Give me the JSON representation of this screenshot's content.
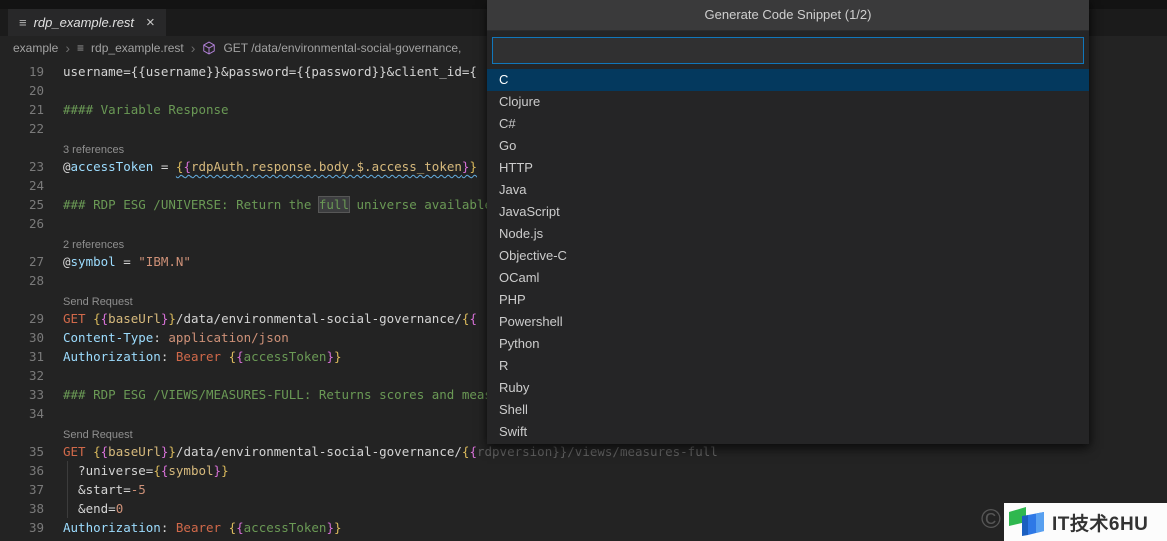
{
  "palette": {
    "plain": "#d4d4d4",
    "comment": "#6a9955",
    "lightBlue": "#9cdcfe",
    "string": "#ce9178",
    "method": "#d1694a",
    "braceGold": "#d9b95c",
    "bracePink": "#d670d6",
    "varGold": "#d7ba7d",
    "green": "#6a9955",
    "dim": "#606060",
    "accent_blue": "#1177bb",
    "selection_bg": "#04395e",
    "brand_green": "#2fb84f",
    "brand_blue": "#2e78e6"
  },
  "tab": {
    "icon_glyph": "≡",
    "title": "rdp_example.rest",
    "close_glyph": "×"
  },
  "breadcrumb": {
    "separator": "›",
    "file_icon_glyph": "≡",
    "segments": [
      "example",
      "rdp_example.rest"
    ],
    "symbol_label": "GET /data/environmental-social-governance,"
  },
  "editor": {
    "rows": [
      {
        "n": 19,
        "seg": [
          [
            "username={{username}}&password={{password}}&client_id={",
            "plain"
          ]
        ]
      },
      {
        "n": 20,
        "seg": []
      },
      {
        "n": 21,
        "seg": [
          [
            "#### Variable Response",
            "comment"
          ]
        ]
      },
      {
        "n": 22,
        "seg": []
      },
      {
        "lens": "3 references"
      },
      {
        "n": 23,
        "seg": [
          [
            "@",
            "plain"
          ],
          [
            "accessToken",
            "lightBlue"
          ],
          [
            " = ",
            "plain"
          ],
          [
            "{",
            "braceGold",
            "wavy"
          ],
          [
            "{",
            "bracePink",
            "wavy"
          ],
          [
            "rdpAuth.response.body.$.access_token",
            "varGold",
            "wavy"
          ],
          [
            "}",
            "bracePink",
            "wavy"
          ],
          [
            "}",
            "braceGold",
            "wavy"
          ]
        ]
      },
      {
        "n": 24,
        "seg": []
      },
      {
        "n": 25,
        "seg": [
          [
            "### RDP ESG /UNIVERSE: Return the ",
            "comment"
          ],
          [
            "full",
            "comment",
            "hl"
          ],
          [
            " universe available",
            "comment"
          ]
        ]
      },
      {
        "n": 26,
        "seg": []
      },
      {
        "lens": "2 references"
      },
      {
        "n": 27,
        "seg": [
          [
            "@",
            "plain"
          ],
          [
            "symbol",
            "lightBlue"
          ],
          [
            " = ",
            "plain"
          ],
          [
            "\"IBM.N\"",
            "string"
          ]
        ]
      },
      {
        "n": 28,
        "seg": []
      },
      {
        "lens": "Send Request"
      },
      {
        "n": 29,
        "seg": [
          [
            "GET",
            "method"
          ],
          [
            " ",
            "plain"
          ],
          [
            "{",
            "braceGold"
          ],
          [
            "{",
            "bracePink"
          ],
          [
            "baseUrl",
            "varGold"
          ],
          [
            "}",
            "bracePink"
          ],
          [
            "}",
            "braceGold"
          ],
          [
            "/data/environmental-social-governance/",
            "plain"
          ],
          [
            "{",
            "braceGold"
          ],
          [
            "{",
            "bracePink"
          ]
        ]
      },
      {
        "n": 30,
        "seg": [
          [
            "Content-Type",
            "lightBlue"
          ],
          [
            ":",
            "plain"
          ],
          [
            " application/json",
            "string"
          ]
        ]
      },
      {
        "n": 31,
        "seg": [
          [
            "Authorization",
            "lightBlue"
          ],
          [
            ": ",
            "plain"
          ],
          [
            "Bearer",
            "method"
          ],
          [
            " ",
            "plain"
          ],
          [
            "{",
            "braceGold"
          ],
          [
            "{",
            "bracePink"
          ],
          [
            "accessToken",
            "green"
          ],
          [
            "}",
            "bracePink"
          ],
          [
            "}",
            "braceGold"
          ]
        ]
      },
      {
        "n": 32,
        "seg": []
      },
      {
        "n": 33,
        "seg": [
          [
            "### RDP ESG /VIEWS/MEASURES-FULL: Returns scores and measures",
            "comment"
          ]
        ]
      },
      {
        "n": 34,
        "seg": []
      },
      {
        "lens": "Send Request"
      },
      {
        "n": 35,
        "seg": [
          [
            "GET",
            "method"
          ],
          [
            " ",
            "plain"
          ],
          [
            "{",
            "braceGold"
          ],
          [
            "{",
            "bracePink"
          ],
          [
            "baseUrl",
            "varGold"
          ],
          [
            "}",
            "bracePink"
          ],
          [
            "}",
            "braceGold"
          ],
          [
            "/data/environmental-social-governance/",
            "plain"
          ],
          [
            "{",
            "braceGold"
          ],
          [
            "{",
            "bracePink"
          ],
          [
            "rdpversion}}/views/measures-full",
            "dim"
          ]
        ]
      },
      {
        "n": 36,
        "guide": true,
        "seg": [
          [
            "  ?universe=",
            "plain"
          ],
          [
            "{",
            "braceGold"
          ],
          [
            "{",
            "bracePink"
          ],
          [
            "symbol",
            "varGold"
          ],
          [
            "}",
            "bracePink"
          ],
          [
            "}",
            "braceGold"
          ]
        ]
      },
      {
        "n": 37,
        "guide": true,
        "seg": [
          [
            "  &start=",
            "plain"
          ],
          [
            "-5",
            "string"
          ]
        ]
      },
      {
        "n": 38,
        "guide": true,
        "seg": [
          [
            "  &end=",
            "plain"
          ],
          [
            "0",
            "string"
          ]
        ]
      },
      {
        "n": 39,
        "seg": [
          [
            "Authorization",
            "lightBlue"
          ],
          [
            ": ",
            "plain"
          ],
          [
            "Bearer",
            "method"
          ],
          [
            " ",
            "plain"
          ],
          [
            "{",
            "braceGold"
          ],
          [
            "{",
            "bracePink"
          ],
          [
            "accessToken",
            "green"
          ],
          [
            "}",
            "bracePink"
          ],
          [
            "}",
            "braceGold"
          ]
        ]
      }
    ]
  },
  "quickpick": {
    "title": "Generate Code Snippet (1/2)",
    "input_value": "",
    "selected_index": 0,
    "items": [
      "C",
      "Clojure",
      "C#",
      "Go",
      "HTTP",
      "Java",
      "JavaScript",
      "Node.js",
      "Objective-C",
      "OCaml",
      "PHP",
      "Powershell",
      "Python",
      "R",
      "Ruby",
      "Shell",
      "Swift"
    ]
  },
  "watermark": {
    "copyright": "©",
    "brand_text": "IT技术6HU"
  }
}
